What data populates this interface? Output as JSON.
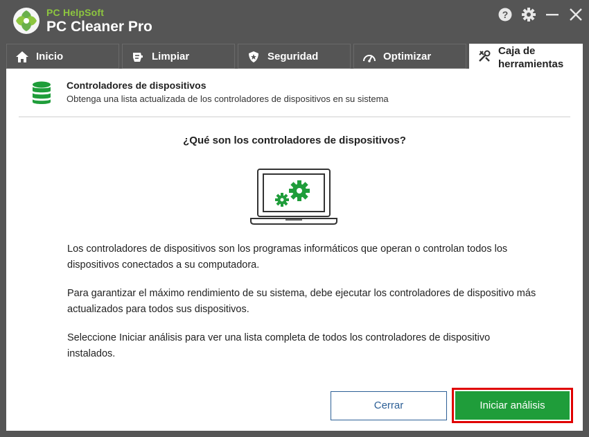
{
  "app": {
    "brand_small": "PC HelpSoft",
    "brand_big": "PC Cleaner Pro"
  },
  "title_controls": [
    {
      "icon": "help-icon"
    },
    {
      "icon": "gear-icon"
    },
    {
      "icon": "minimize-icon"
    },
    {
      "icon": "close-icon"
    }
  ],
  "tabs": [
    {
      "label": "Inicio",
      "icon": "home-icon"
    },
    {
      "label": "Limpiar",
      "icon": "clean-icon"
    },
    {
      "label": "Seguridad",
      "icon": "shield-icon"
    },
    {
      "label": "Optimizar",
      "icon": "speedometer-icon"
    },
    {
      "label": "Caja de herramientas",
      "icon": "tools-icon",
      "active": true
    }
  ],
  "header": {
    "title": "Controladores de dispositivos",
    "subtitle": "Obtenga una lista actualizada de los controladores de dispositivos en su sistema",
    "icon": "database-icon"
  },
  "main": {
    "question": "¿Qué son los controladores de dispositivos?",
    "illustration": "laptop-gears-icon",
    "paragraphs": [
      "Los controladores de dispositivos son los programas informáticos que operan o controlan todos los dispositivos conectados a su computadora.",
      "Para garantizar el máximo rendimiento de su sistema, debe ejecutar los controladores de dispositivo más actualizados para todos sus dispositivos.",
      "Seleccione Iniciar análisis para ver una lista completa de todos los controladores de dispositivo instalados."
    ]
  },
  "buttons": {
    "close_label": "Cerrar",
    "start_label": "Iniciar análisis"
  },
  "colors": {
    "accent_green": "#1f9d3a",
    "brand_green": "#8dc63f",
    "highlight_red": "#e00000",
    "link_blue": "#2c5f96",
    "chrome": "#555555"
  }
}
